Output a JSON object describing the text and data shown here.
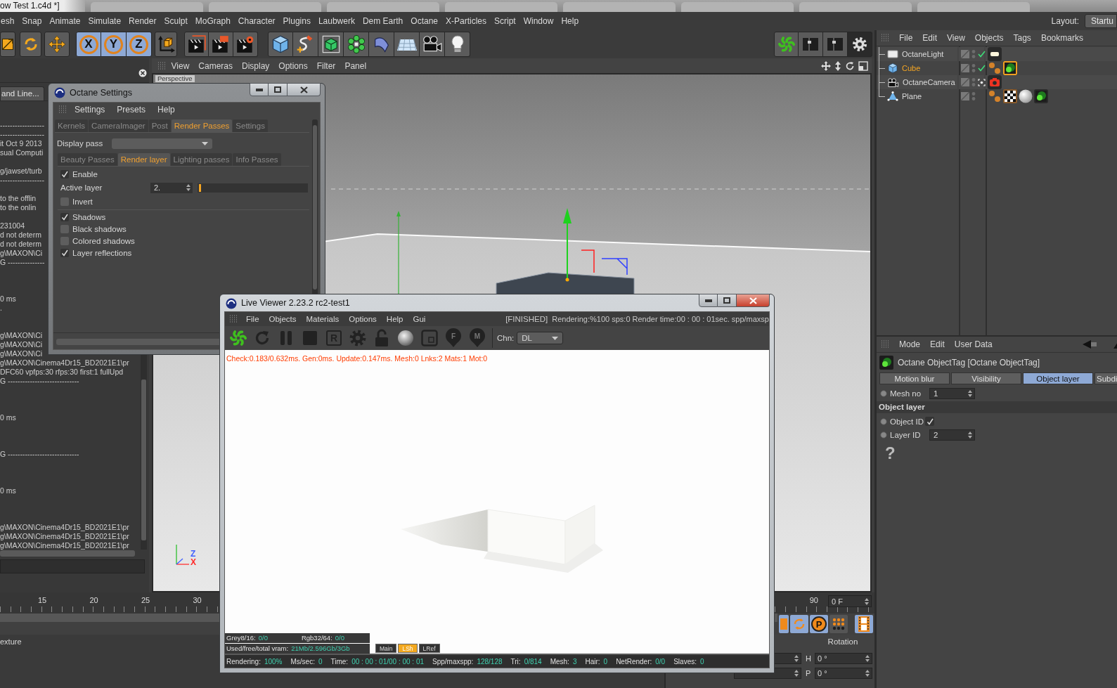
{
  "window": {
    "title": "ow Test 1.c4d *]"
  },
  "menu_bar": {
    "items": [
      "esh",
      "Snap",
      "Animate",
      "Simulate",
      "Render",
      "Sculpt",
      "MoGraph",
      "Character",
      "Plugins",
      "Laubwerk",
      "Dem Earth",
      "Octane",
      "X-Particles",
      "Script",
      "Window",
      "Help"
    ],
    "layout_label": "Layout:",
    "layout_value": "Startu"
  },
  "toolbar": {
    "axis_buttons": [
      {
        "label": "X",
        "on": true
      },
      {
        "label": "Y",
        "on": true
      },
      {
        "label": "Z",
        "on": true
      }
    ]
  },
  "console": {
    "tab": "and Line...",
    "lines": [
      {
        "kind": "text",
        "text": "------------------"
      },
      {
        "kind": "text",
        "text": "------------------"
      },
      {
        "kind": "text",
        "text": "it Oct 9 2013"
      },
      {
        "kind": "text",
        "text": "sual Computi"
      },
      {
        "kind": "blank"
      },
      {
        "kind": "text",
        "text": "g/jawset/turb"
      },
      {
        "kind": "text",
        "text": "------------------"
      },
      {
        "kind": "blank"
      },
      {
        "kind": "text",
        "text": "to the offlin"
      },
      {
        "kind": "text",
        "text": "to the onlin"
      },
      {
        "kind": "blank"
      },
      {
        "kind": "text",
        "text": "231004"
      },
      {
        "kind": "text",
        "text": "d not determ"
      },
      {
        "kind": "text",
        "text": "d not determ"
      },
      {
        "kind": "text",
        "text": "g\\MAXON\\Ci"
      },
      {
        "kind": "text",
        "text": "G ---------------"
      },
      {
        "kind": "blank"
      },
      {
        "kind": "blank"
      },
      {
        "kind": "blank"
      },
      {
        "kind": "text",
        "text": "0 ms"
      },
      {
        "kind": "text",
        "text": "."
      },
      {
        "kind": "blank"
      },
      {
        "kind": "blank"
      },
      {
        "kind": "text",
        "text": "g\\MAXON\\Ci"
      },
      {
        "kind": "text",
        "text": "g\\MAXON\\Ci"
      },
      {
        "kind": "text",
        "text": "g\\MAXON\\Ci"
      },
      {
        "kind": "text",
        "text": "g\\MAXON\\Cinema4Dr15_BD2021E1\\pr"
      },
      {
        "kind": "text",
        "text": "DFC60 vpfps:30 rfps:30 first:1 fullUpd"
      },
      {
        "kind": "text",
        "text": "G -----------------------------"
      },
      {
        "kind": "blank"
      },
      {
        "kind": "blank"
      },
      {
        "kind": "blank"
      },
      {
        "kind": "text",
        "text": "0 ms"
      },
      {
        "kind": "blank"
      },
      {
        "kind": "blank"
      },
      {
        "kind": "blank"
      },
      {
        "kind": "text",
        "text": "G -----------------------------"
      },
      {
        "kind": "blank"
      },
      {
        "kind": "blank"
      },
      {
        "kind": "blank"
      },
      {
        "kind": "text",
        "text": "0 ms"
      },
      {
        "kind": "blank"
      },
      {
        "kind": "blank"
      },
      {
        "kind": "blank"
      },
      {
        "kind": "text",
        "text": "g\\MAXON\\Cinema4Dr15_BD2021E1\\pr"
      },
      {
        "kind": "text",
        "text": "g\\MAXON\\Cinema4Dr15_BD2021E1\\pr"
      },
      {
        "kind": "text",
        "text": "g\\MAXON\\Cinema4Dr15_BD2021E1\\pr"
      }
    ]
  },
  "viewport": {
    "menu": [
      "View",
      "Cameras",
      "Display",
      "Options",
      "Filter",
      "Panel"
    ],
    "camera_label": "Perspective",
    "axis_labels": [
      {
        "label": "Z",
        "color": "#3f5fff"
      },
      {
        "label": "X",
        "color": "#ff2a2a"
      }
    ]
  },
  "octane_settings": {
    "title": "Octane Settings",
    "menu": [
      "Settings",
      "Presets",
      "Help"
    ],
    "tabs": [
      {
        "label": "Kernels",
        "selected": false
      },
      {
        "label": "CameraImager",
        "selected": false
      },
      {
        "label": "Post",
        "selected": false
      },
      {
        "label": "Render Passes",
        "selected": true
      },
      {
        "label": "Settings",
        "selected": false
      }
    ],
    "display_pass_label": "Display pass",
    "subtabs": [
      {
        "label": "Beauty Passes",
        "selected": false
      },
      {
        "label": "Render layer",
        "selected": true
      },
      {
        "label": "Lighting passes",
        "selected": false
      },
      {
        "label": "Info Passes",
        "selected": false
      }
    ],
    "options": [
      {
        "kind": "checkbox",
        "label": "Enable",
        "checked": true
      },
      {
        "kind": "slider",
        "label": "Active layer",
        "value": "2.",
        "level": 0.01
      },
      {
        "kind": "checkbox",
        "label": "Invert",
        "checked": false
      },
      {
        "kind": "separator"
      },
      {
        "kind": "checkbox",
        "label": "Shadows",
        "checked": true
      },
      {
        "kind": "checkbox",
        "label": "Black shadows",
        "checked": false
      },
      {
        "kind": "checkbox",
        "label": "Colored shadows",
        "checked": false
      },
      {
        "kind": "checkbox",
        "label": "Layer reflections",
        "checked": true
      }
    ]
  },
  "live_viewer": {
    "title": "Live Viewer 2.23.2 rc2-test1",
    "menu": [
      "File",
      "Objects",
      "Materials",
      "Options",
      "Help",
      "Gui"
    ],
    "state": "[FINISHED]",
    "progress": "Rendering:%100 sps:0 Render time:00 : 00 : 01sec. spp/maxsp",
    "letter_button": "R",
    "pins": [
      "F",
      "M"
    ],
    "channel_label": "Chn:",
    "channel_value": "DL",
    "stats": "Check:0.183/0.632ms. Gen:0ms. Update:0.147ms. Mesh:0 Lnks:2 Mats:1 Mot:0",
    "info": [
      {
        "label": "Grey8/16:",
        "value": "0/0"
      },
      {
        "label": "Rgb32/64:",
        "value": "0/0"
      }
    ],
    "vram": {
      "label": "Used/free/total vram:",
      "value": "21Mb/2.596Gb/3Gb"
    },
    "view_buttons": [
      {
        "label": "Main",
        "selected": false
      },
      {
        "label": "LSh",
        "selected": true
      },
      {
        "label": "LRef",
        "selected": false
      }
    ],
    "status_bar": [
      {
        "label": "Rendering:",
        "value": "100%"
      },
      {
        "label": "Ms/sec:",
        "value": "0"
      },
      {
        "label": "Time:",
        "value": "00 : 00 : 01/00 : 00 : 01"
      },
      {
        "label": "Spp/maxspp:",
        "value": "128/128"
      },
      {
        "label": "Tri:",
        "value": "0/814"
      },
      {
        "label": "Mesh:",
        "value": "3"
      },
      {
        "label": "Hair:",
        "value": "0"
      },
      {
        "label": "NetRender:",
        "value": "0/0"
      },
      {
        "label": "Slaves:",
        "value": "0"
      }
    ]
  },
  "object_manager": {
    "menu": [
      "File",
      "Edit",
      "View",
      "Objects",
      "Tags",
      "Bookmarks"
    ],
    "objects": [
      {
        "name": "OctaneLight",
        "kind": "light",
        "selected": false,
        "activation": {
          "kind": "check"
        },
        "tags": [
          {
            "kind": "lamp",
            "selected": false
          }
        ]
      },
      {
        "name": "Cube",
        "kind": "cube",
        "selected": true,
        "activation": {
          "kind": "check"
        },
        "tags": [
          {
            "kind": "balls",
            "selected": false
          },
          {
            "kind": "circles",
            "selected": true
          }
        ]
      },
      {
        "name": "OctaneCamera",
        "kind": "camera",
        "selected": false,
        "activation": {
          "kind": "camera"
        },
        "tags": [
          {
            "kind": "camera",
            "selected": false
          }
        ]
      },
      {
        "name": "Plane",
        "kind": "plane",
        "selected": false,
        "tags": [
          {
            "kind": "balls",
            "selected": false
          },
          {
            "kind": "checker",
            "selected": false
          },
          {
            "kind": "sphere",
            "selected": false
          },
          {
            "kind": "circles",
            "selected": false
          }
        ]
      }
    ]
  },
  "attribute_manager": {
    "menu": [
      "Mode",
      "Edit",
      "User Data"
    ],
    "header": "Octane ObjectTag [Octane ObjectTag]",
    "tabs": [
      {
        "label": "Motion blur",
        "selected": false
      },
      {
        "label": "Visibility",
        "selected": false
      },
      {
        "label": "Object layer",
        "selected": true
      },
      {
        "label": "Subdi",
        "selected": false
      }
    ],
    "fields": [
      {
        "kind": "number",
        "label": "Mesh no",
        "value": "1"
      },
      {
        "kind": "section",
        "label": "Object layer"
      },
      {
        "kind": "checkbox",
        "label": "Object ID",
        "checked": true
      },
      {
        "kind": "number",
        "label": "Layer ID",
        "value": "2"
      }
    ],
    "help": "?"
  },
  "timeline": {
    "labels": [
      "15",
      "20",
      "25",
      "30"
    ],
    "end_label": "90",
    "frame_field": "0 F",
    "key_buttons": [
      {
        "kind": "key",
        "on": true
      },
      {
        "kind": "autokey",
        "on": true
      },
      {
        "kind": "letter",
        "label": "P",
        "on": true
      },
      {
        "kind": "dots",
        "on": false
      },
      {
        "kind": "film",
        "on": true
      }
    ]
  },
  "coordinates": {
    "material_tab": "exture",
    "heading": "Rotation",
    "rows": [
      {
        "axis": "H",
        "value": "0 °"
      },
      {
        "axis": "P",
        "value": "0 °"
      }
    ]
  }
}
